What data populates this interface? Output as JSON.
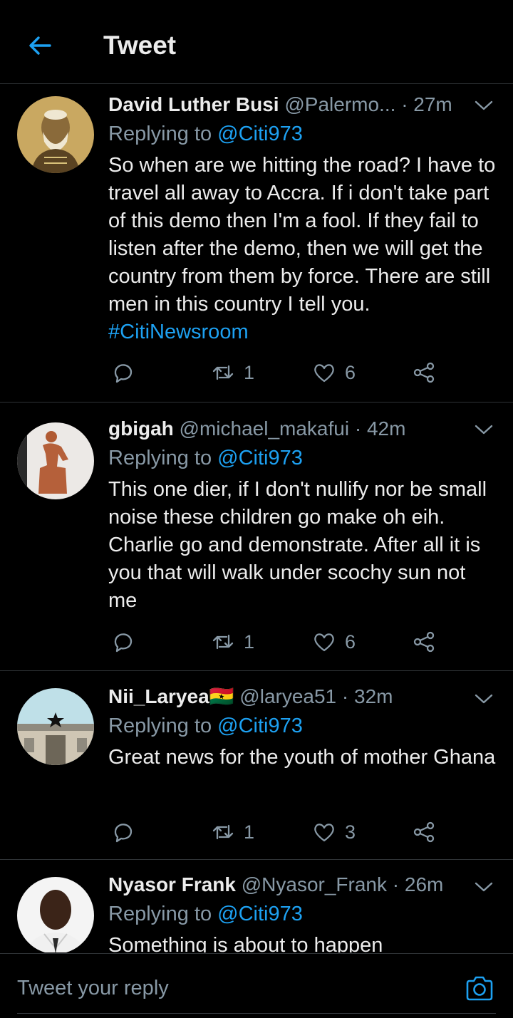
{
  "header": {
    "title": "Tweet",
    "back_icon": "arrow-left-icon",
    "accent": "#1da1f2"
  },
  "tweets": [
    {
      "name": "David Luther Busi",
      "handle": "@Palermo...",
      "time": "· 27m",
      "replying_prefix": "Replying to ",
      "replying_to": "@Citi973",
      "text": "So when are we hitting the road? I have to travel all away to Accra. If i don't take part of this demo then I'm a fool. If they fail to listen after the demo, then we will get the country from them by force. There are still men in this country I tell ",
      "text_tail": "you. ",
      "hashtag": "#CitiNewsroom",
      "retweets": "1",
      "likes": "6"
    },
    {
      "name": "gbigah",
      "handle": "@michael_makafui",
      "time": "· 42m",
      "replying_prefix": "Replying to ",
      "replying_to": "@Citi973",
      "text": "This one dier, if I don't nullify nor be small noise these children go make oh eih. Charlie go and demonstrate. After all it is you that will walk under scochy sun not me",
      "retweets": "1",
      "likes": "6"
    },
    {
      "name": "Nii_Laryea",
      "flag": "🇬🇭",
      "handle": "@laryea51",
      "time": "· 32m",
      "replying_prefix": "Replying to ",
      "replying_to": "@Citi973",
      "text": "Great news for the youth of mother Ghana",
      "retweets": "1",
      "likes": "3"
    },
    {
      "name": "Nyasor Frank",
      "handle": "@Nyasor_Frank",
      "time": "· 26m",
      "replying_prefix": "Replying to ",
      "replying_to": "@Citi973",
      "text": "Something is about to happen"
    }
  ],
  "composer": {
    "placeholder": "Tweet your reply",
    "camera_icon": "camera-icon"
  }
}
